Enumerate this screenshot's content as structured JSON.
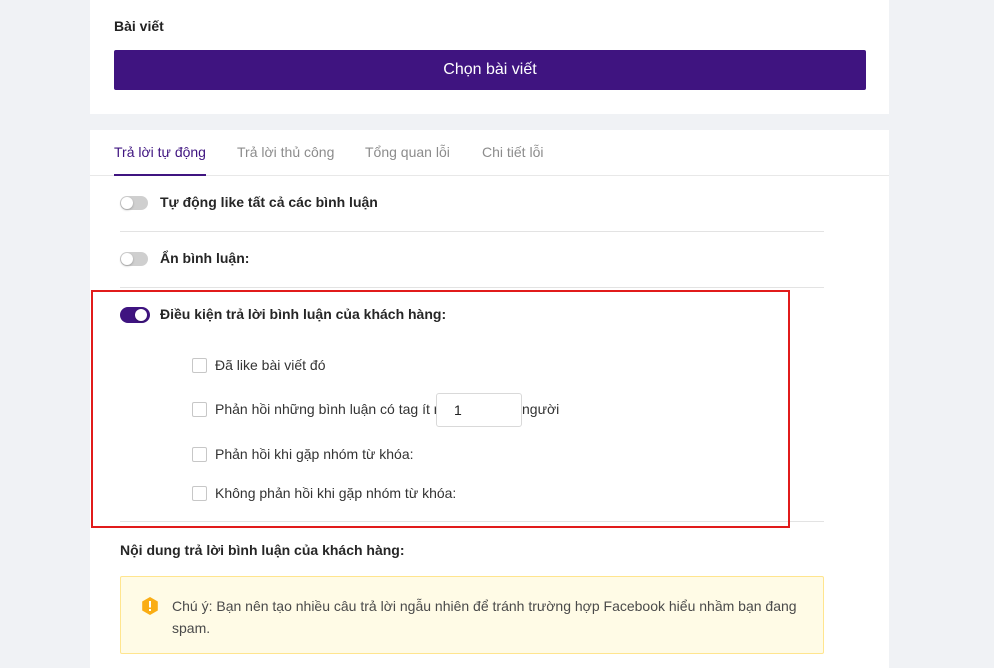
{
  "post_section": {
    "label": "Bài viết",
    "choose_button": "Chọn bài viết"
  },
  "tabs": [
    {
      "label": "Trả lời tự động",
      "active": true
    },
    {
      "label": "Trả lời thủ công",
      "active": false
    },
    {
      "label": "Tổng quan lỗi",
      "active": false
    },
    {
      "label": "Chi tiết lỗi",
      "active": false
    }
  ],
  "toggles": [
    {
      "label": "Tự động like tất cả các bình luận",
      "on": false
    },
    {
      "label": "Ẩn bình luận:",
      "on": false
    },
    {
      "label": "Điều kiện trả lời bình luận của khách hàng:",
      "on": true
    }
  ],
  "conditions": {
    "liked_post": {
      "label": "Đã like bài viết đó",
      "checked": false
    },
    "tag_min": {
      "label": "Phản hồi những bình luận có tag ít nhất:",
      "value": "1",
      "unit": "người",
      "checked": false
    },
    "keyword_group": {
      "label": "Phản hồi khi gặp nhóm từ khóa:",
      "checked": false
    },
    "no_keyword_group": {
      "label": "Không phản hồi khi gặp nhóm từ khóa:",
      "checked": false
    }
  },
  "reply_content": {
    "title": "Nội dung trả lời bình luận của khách hàng:",
    "notice": "Chú ý: Bạn nên tạo nhiều câu trả lời ngẫu nhiên để tránh trường hợp Facebook hiểu nhầm bạn đang spam.",
    "notice_icon": "warning-icon"
  },
  "colors": {
    "accent": "#3f1480",
    "highlight_border": "#e11b1b",
    "notice_bg": "#fffbe6",
    "notice_border": "#ffe58f",
    "warning": "#faad14"
  }
}
